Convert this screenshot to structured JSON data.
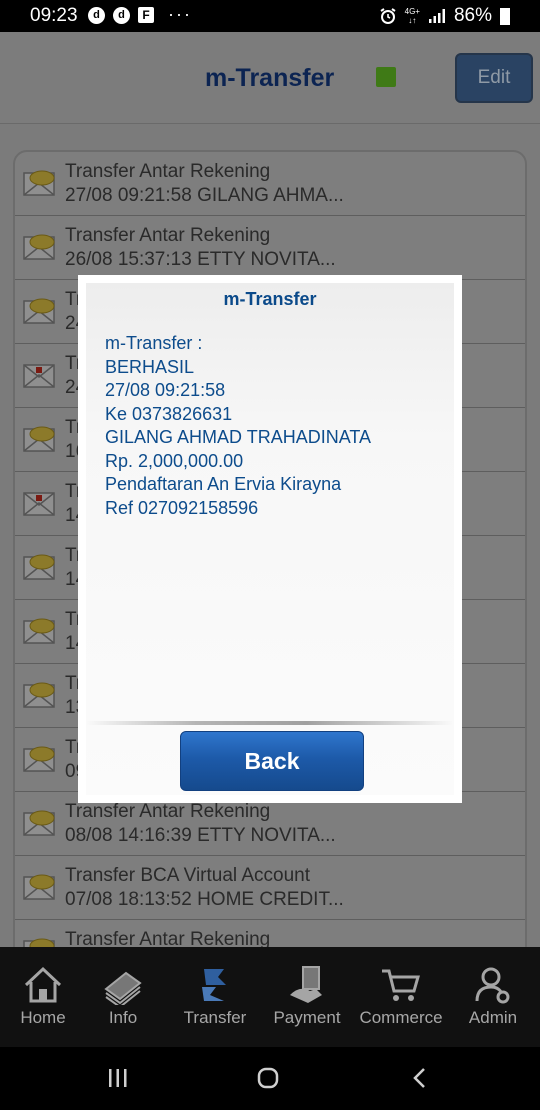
{
  "status_bar": {
    "time": "09:23",
    "notif1": "d",
    "notif2": "d",
    "notif3": "F",
    "more": "···",
    "net_top": "4G+",
    "battery": "86%"
  },
  "header": {
    "title": "m-Transfer",
    "edit_label": "Edit",
    "indicator_color": "#3f7a16"
  },
  "list": {
    "rows": [
      {
        "title": "Transfer Antar Rekening",
        "detail": "27/08 09:21:58 GILANG AHMA...",
        "icon": "envelope-icon"
      },
      {
        "title": "Transfer Antar Rekening",
        "detail": "26/08 15:37:13 ETTY NOVITA...",
        "icon": "envelope-icon"
      },
      {
        "title": "Tr",
        "detail": "24",
        "icon": "envelope-icon"
      },
      {
        "title": "Tr",
        "detail": "24",
        "icon": "envelope-open-icon"
      },
      {
        "title": "Tr",
        "detail": "16",
        "icon": "envelope-icon"
      },
      {
        "title": "Tr",
        "detail": "14",
        "icon": "envelope-open-icon"
      },
      {
        "title": "Tr",
        "detail": "14",
        "icon": "envelope-icon"
      },
      {
        "title": "Tr",
        "detail": "14",
        "icon": "envelope-icon"
      },
      {
        "title": "Tr",
        "detail": "13",
        "icon": "envelope-icon"
      },
      {
        "title": "Tr",
        "detail": "09",
        "icon": "envelope-icon"
      },
      {
        "title": "Transfer Antar Rekening",
        "detail": "08/08 14:16:39 ETTY NOVITA...",
        "icon": "envelope-icon"
      },
      {
        "title": "Transfer BCA Virtual Account",
        "detail": "07/08 18:13:52 HOME CREDIT...",
        "icon": "envelope-icon"
      },
      {
        "title": "Transfer Antar Rekening",
        "detail": "",
        "icon": "envelope-icon"
      }
    ]
  },
  "dialog": {
    "title": "m-Transfer",
    "lines": [
      "m-Transfer :",
      "BERHASIL",
      "27/08 09:21:58",
      "Ke 0373826631",
      "GILANG AHMAD TRAHADINATA",
      "Rp. 2,000,000.00",
      "Pendaftaran An Ervia Kirayna",
      "Ref 027092158596"
    ],
    "back_label": "Back",
    "text_color": "#0d4c8c"
  },
  "bottom_nav": {
    "items": [
      {
        "label": "Home",
        "icon": "home-icon"
      },
      {
        "label": "Info",
        "icon": "info-icon"
      },
      {
        "label": "Transfer",
        "icon": "transfer-icon"
      },
      {
        "label": "Payment",
        "icon": "payment-icon"
      },
      {
        "label": "Commerce",
        "icon": "cart-icon"
      },
      {
        "label": "Admin",
        "icon": "admin-icon"
      }
    ]
  }
}
